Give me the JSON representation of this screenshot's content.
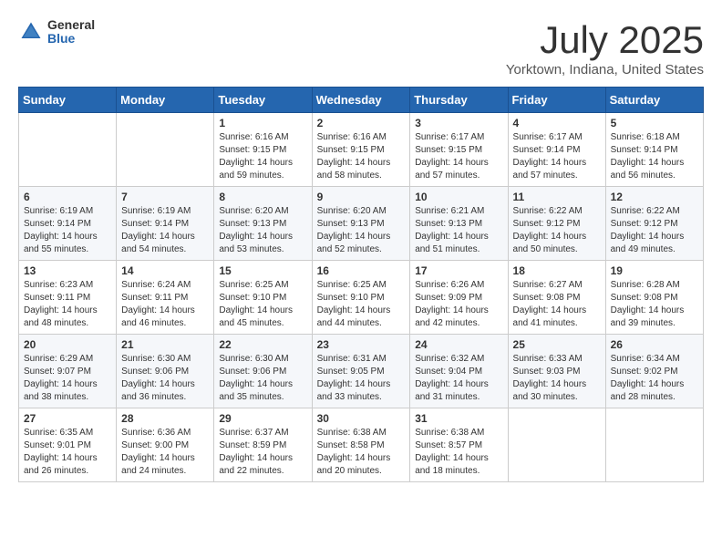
{
  "header": {
    "logo_general": "General",
    "logo_blue": "Blue",
    "month_title": "July 2025",
    "location": "Yorktown, Indiana, United States"
  },
  "weekdays": [
    "Sunday",
    "Monday",
    "Tuesday",
    "Wednesday",
    "Thursday",
    "Friday",
    "Saturday"
  ],
  "weeks": [
    [
      {
        "day": "",
        "info": ""
      },
      {
        "day": "",
        "info": ""
      },
      {
        "day": "1",
        "info": "Sunrise: 6:16 AM\nSunset: 9:15 PM\nDaylight: 14 hours and 59 minutes."
      },
      {
        "day": "2",
        "info": "Sunrise: 6:16 AM\nSunset: 9:15 PM\nDaylight: 14 hours and 58 minutes."
      },
      {
        "day": "3",
        "info": "Sunrise: 6:17 AM\nSunset: 9:15 PM\nDaylight: 14 hours and 57 minutes."
      },
      {
        "day": "4",
        "info": "Sunrise: 6:17 AM\nSunset: 9:14 PM\nDaylight: 14 hours and 57 minutes."
      },
      {
        "day": "5",
        "info": "Sunrise: 6:18 AM\nSunset: 9:14 PM\nDaylight: 14 hours and 56 minutes."
      }
    ],
    [
      {
        "day": "6",
        "info": "Sunrise: 6:19 AM\nSunset: 9:14 PM\nDaylight: 14 hours and 55 minutes."
      },
      {
        "day": "7",
        "info": "Sunrise: 6:19 AM\nSunset: 9:14 PM\nDaylight: 14 hours and 54 minutes."
      },
      {
        "day": "8",
        "info": "Sunrise: 6:20 AM\nSunset: 9:13 PM\nDaylight: 14 hours and 53 minutes."
      },
      {
        "day": "9",
        "info": "Sunrise: 6:20 AM\nSunset: 9:13 PM\nDaylight: 14 hours and 52 minutes."
      },
      {
        "day": "10",
        "info": "Sunrise: 6:21 AM\nSunset: 9:13 PM\nDaylight: 14 hours and 51 minutes."
      },
      {
        "day": "11",
        "info": "Sunrise: 6:22 AM\nSunset: 9:12 PM\nDaylight: 14 hours and 50 minutes."
      },
      {
        "day": "12",
        "info": "Sunrise: 6:22 AM\nSunset: 9:12 PM\nDaylight: 14 hours and 49 minutes."
      }
    ],
    [
      {
        "day": "13",
        "info": "Sunrise: 6:23 AM\nSunset: 9:11 PM\nDaylight: 14 hours and 48 minutes."
      },
      {
        "day": "14",
        "info": "Sunrise: 6:24 AM\nSunset: 9:11 PM\nDaylight: 14 hours and 46 minutes."
      },
      {
        "day": "15",
        "info": "Sunrise: 6:25 AM\nSunset: 9:10 PM\nDaylight: 14 hours and 45 minutes."
      },
      {
        "day": "16",
        "info": "Sunrise: 6:25 AM\nSunset: 9:10 PM\nDaylight: 14 hours and 44 minutes."
      },
      {
        "day": "17",
        "info": "Sunrise: 6:26 AM\nSunset: 9:09 PM\nDaylight: 14 hours and 42 minutes."
      },
      {
        "day": "18",
        "info": "Sunrise: 6:27 AM\nSunset: 9:08 PM\nDaylight: 14 hours and 41 minutes."
      },
      {
        "day": "19",
        "info": "Sunrise: 6:28 AM\nSunset: 9:08 PM\nDaylight: 14 hours and 39 minutes."
      }
    ],
    [
      {
        "day": "20",
        "info": "Sunrise: 6:29 AM\nSunset: 9:07 PM\nDaylight: 14 hours and 38 minutes."
      },
      {
        "day": "21",
        "info": "Sunrise: 6:30 AM\nSunset: 9:06 PM\nDaylight: 14 hours and 36 minutes."
      },
      {
        "day": "22",
        "info": "Sunrise: 6:30 AM\nSunset: 9:06 PM\nDaylight: 14 hours and 35 minutes."
      },
      {
        "day": "23",
        "info": "Sunrise: 6:31 AM\nSunset: 9:05 PM\nDaylight: 14 hours and 33 minutes."
      },
      {
        "day": "24",
        "info": "Sunrise: 6:32 AM\nSunset: 9:04 PM\nDaylight: 14 hours and 31 minutes."
      },
      {
        "day": "25",
        "info": "Sunrise: 6:33 AM\nSunset: 9:03 PM\nDaylight: 14 hours and 30 minutes."
      },
      {
        "day": "26",
        "info": "Sunrise: 6:34 AM\nSunset: 9:02 PM\nDaylight: 14 hours and 28 minutes."
      }
    ],
    [
      {
        "day": "27",
        "info": "Sunrise: 6:35 AM\nSunset: 9:01 PM\nDaylight: 14 hours and 26 minutes."
      },
      {
        "day": "28",
        "info": "Sunrise: 6:36 AM\nSunset: 9:00 PM\nDaylight: 14 hours and 24 minutes."
      },
      {
        "day": "29",
        "info": "Sunrise: 6:37 AM\nSunset: 8:59 PM\nDaylight: 14 hours and 22 minutes."
      },
      {
        "day": "30",
        "info": "Sunrise: 6:38 AM\nSunset: 8:58 PM\nDaylight: 14 hours and 20 minutes."
      },
      {
        "day": "31",
        "info": "Sunrise: 6:38 AM\nSunset: 8:57 PM\nDaylight: 14 hours and 18 minutes."
      },
      {
        "day": "",
        "info": ""
      },
      {
        "day": "",
        "info": ""
      }
    ]
  ]
}
